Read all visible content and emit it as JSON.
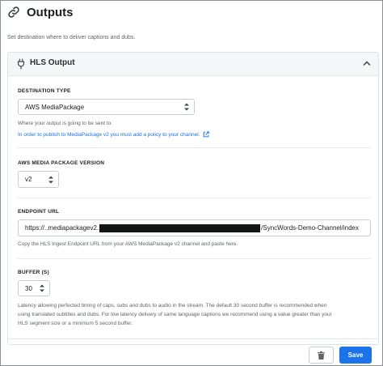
{
  "header": {
    "title": "Outputs",
    "icon": "link-icon"
  },
  "subtitle": "Set destination where to deliver captions and dubs.",
  "panel": {
    "title": "HLS Output",
    "icon": "plug-icon",
    "collapse_icon": "chevron-up-icon"
  },
  "destination": {
    "label": "DESTINATION TYPE",
    "value": "AWS MediaPackage",
    "help": "Where your output is going to be sent to.",
    "link": "In order to publish to MediaPackage v2 you must add a policy to your channel."
  },
  "version": {
    "label": "AWS MEDIA PACKAGE VERSION",
    "value": "v2"
  },
  "endpoint": {
    "label": "ENDPOINT URL",
    "value_start": "https://..mediapackagev2.",
    "value_end": "/SyncWords-Demo-Channel/index",
    "help": "Copy the HLS Ingest Endpoint URL from your AWS MediaPackage v2 channel and paste here."
  },
  "buffer": {
    "label": "BUFFER (S)",
    "value": "30",
    "help": [
      "Latency allowing perfected timing of caps, subs and dubs to audio in the stream. The default 30 second buffer is recommended when",
      "using translated subtitles and dubs. For low latency delivery of same language captions we recommend using a value greater than your",
      "HLS segment size or a minimum 5 second buffer."
    ]
  },
  "footer": {
    "save_label": "Save",
    "delete_icon": "trash-icon"
  },
  "colors": {
    "accent": "#1a73e8",
    "panel_header": "#f5f6f8"
  }
}
